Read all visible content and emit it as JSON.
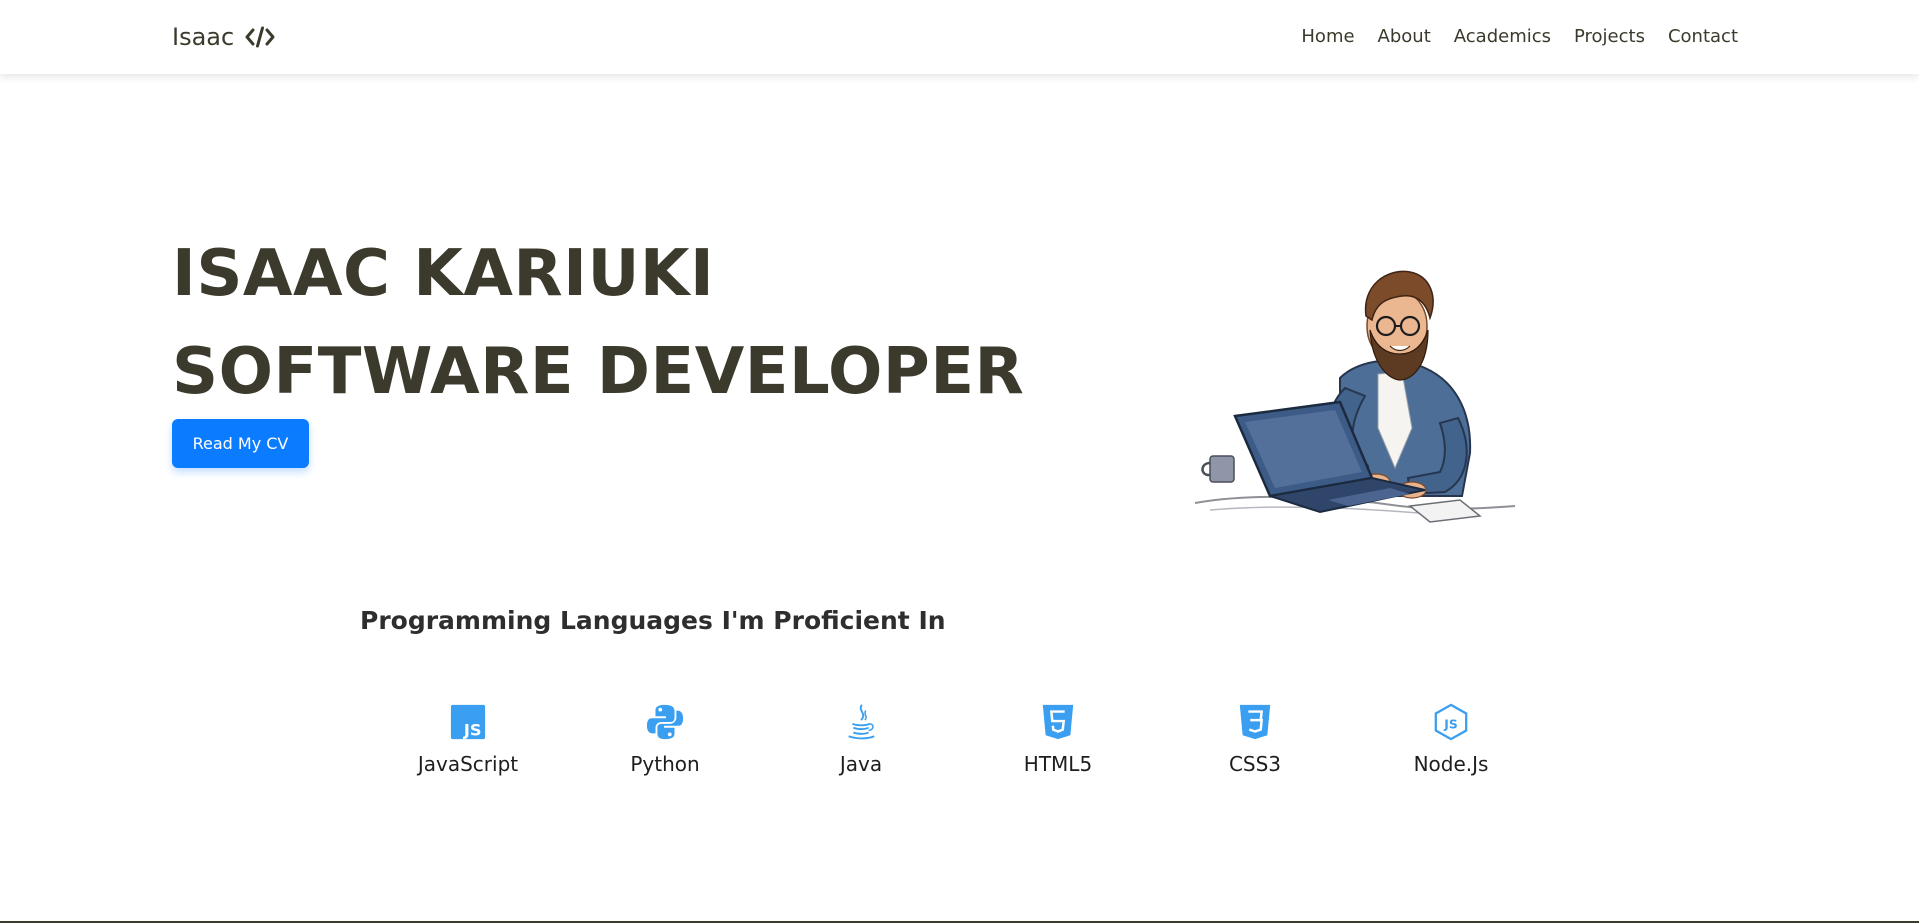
{
  "nav": {
    "brand": "Isaac",
    "brand_icon": "code-icon",
    "links": [
      "Home",
      "About",
      "Academics",
      "Projects",
      "Contact"
    ]
  },
  "hero": {
    "line1": "ISAAC KARIUKI",
    "line2": "SOFTWARE DEVELOPER",
    "cv_button": "Read My CV",
    "illustration": "developer-laptop-illustration"
  },
  "skills": {
    "heading": "Programming Languages I'm Proficient In",
    "items": [
      {
        "label": "JavaScript",
        "icon": "javascript-icon"
      },
      {
        "label": "Python",
        "icon": "python-icon"
      },
      {
        "label": "Java",
        "icon": "java-icon"
      },
      {
        "label": "HTML5",
        "icon": "html5-icon"
      },
      {
        "label": "CSS3",
        "icon": "css3-icon"
      },
      {
        "label": "Node.Js",
        "icon": "nodejs-icon"
      }
    ]
  },
  "colors": {
    "text": "#3b3a2c",
    "accent": "#0b7cff",
    "icon": "#3a9ff0"
  }
}
